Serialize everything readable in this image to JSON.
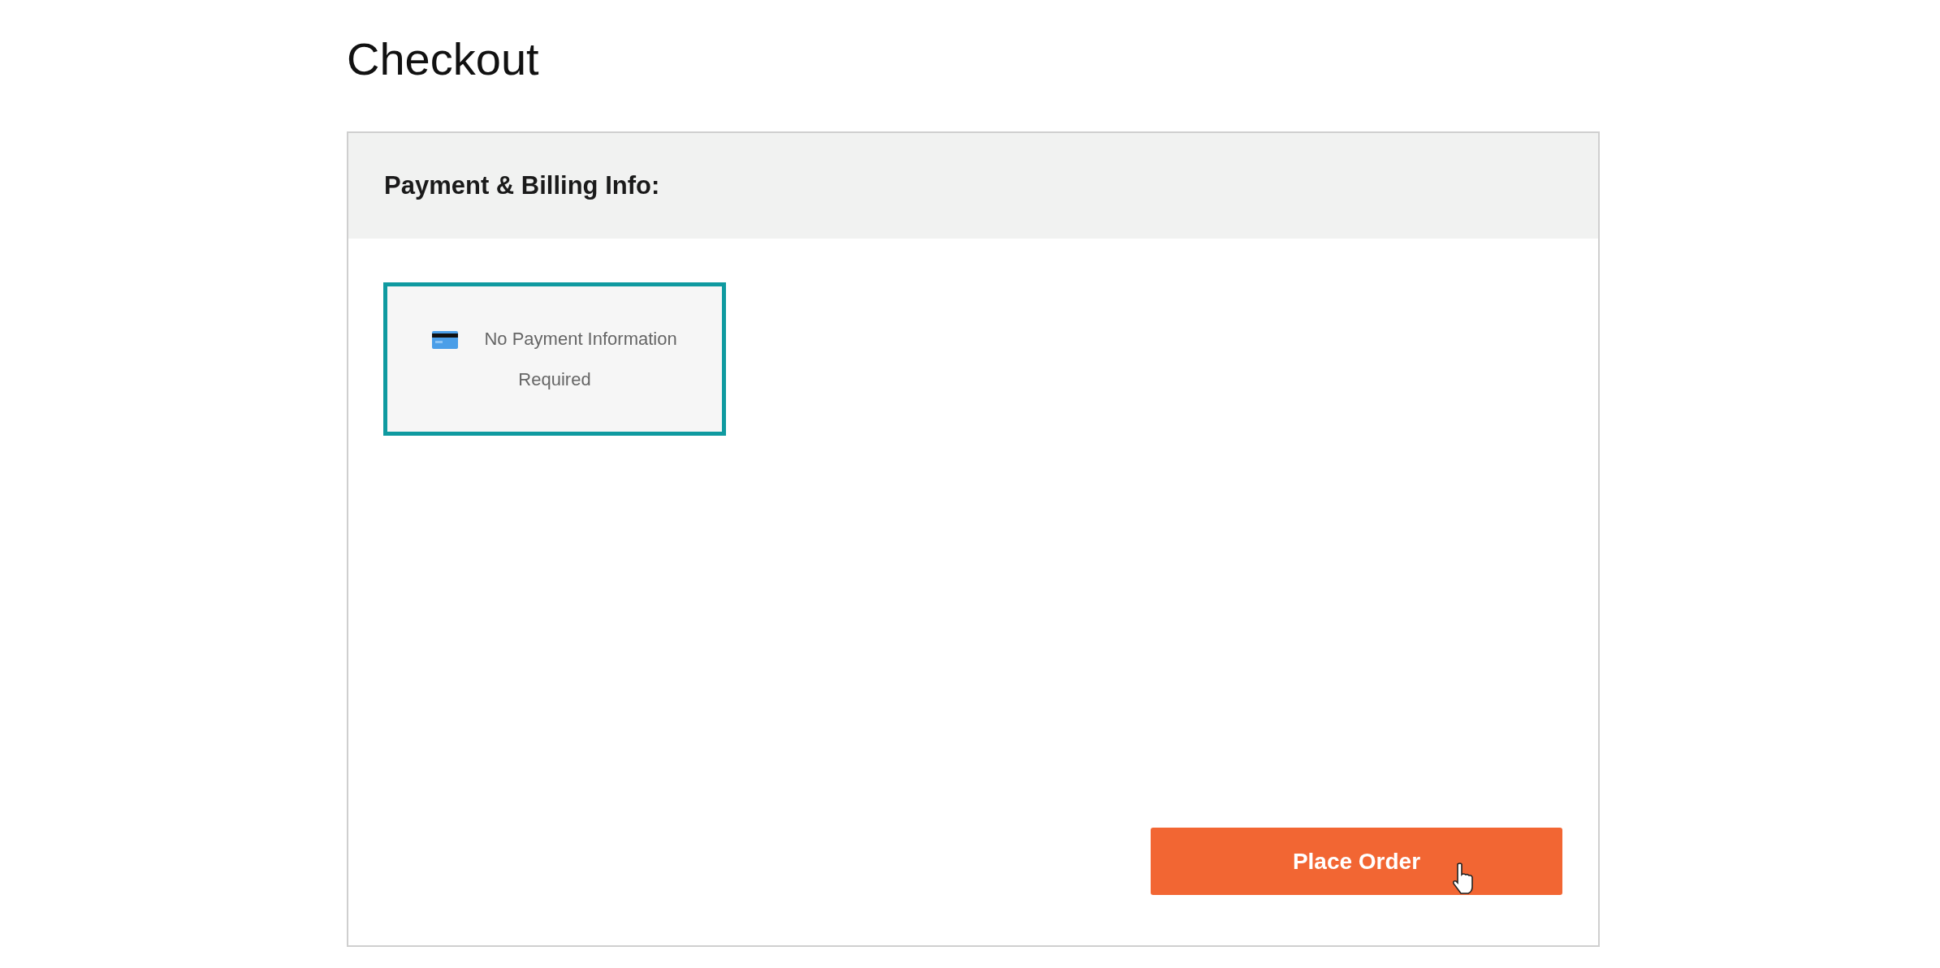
{
  "page": {
    "title": "Checkout"
  },
  "panel": {
    "header": "Payment & Billing Info:",
    "payment_options": [
      {
        "kind": "card",
        "label": "No Payment Information Required",
        "selected": true
      }
    ],
    "button": {
      "label": "Place Order"
    }
  }
}
